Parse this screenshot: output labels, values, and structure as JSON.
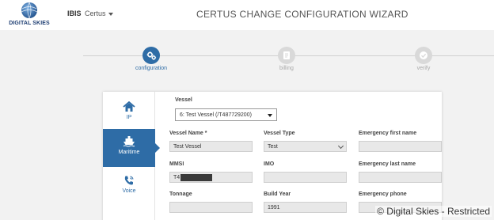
{
  "header": {
    "logo_text": "DIGITAL SKIES",
    "brand": "IBIS",
    "product_menu": "Certus",
    "title": "CERTUS CHANGE CONFIGURATION WIZARD"
  },
  "steps": [
    {
      "label": "configuration",
      "icon": "gears-icon",
      "state": "active"
    },
    {
      "label": "billing",
      "icon": "document-icon",
      "state": "inactive"
    },
    {
      "label": "verify",
      "icon": "check-icon",
      "state": "inactive"
    }
  ],
  "side_nav": [
    {
      "label": "IP",
      "icon": "home-icon",
      "selected": false
    },
    {
      "label": "Maritime",
      "icon": "ship-icon",
      "selected": true
    },
    {
      "label": "Voice",
      "icon": "phone-icon",
      "selected": false
    }
  ],
  "form": {
    "vessel_label": "Vessel",
    "vessel_selected": "6: Test Vessel (/T487729200)",
    "vessel_name_label": "Vessel Name *",
    "vessel_name_value": "Test Vessel",
    "vessel_type_label": "Vessel Type",
    "vessel_type_value": "Test",
    "emergency_first_name_label": "Emergency first name",
    "emergency_first_name_value": "",
    "mmsi_label": "MMSI",
    "mmsi_value_visible": "T4",
    "imo_label": "IMO",
    "imo_value": "",
    "emergency_last_name_label": "Emergency last name",
    "emergency_last_name_value": "",
    "tonnage_label": "Tonnage",
    "tonnage_value": "",
    "build_year_label": "Build Year",
    "build_year_value": "1991",
    "emergency_phone_label": "Emergency phone",
    "emergency_phone_value": ""
  },
  "watermark": "© Digital Skies - Restricted",
  "colors": {
    "accent": "#2e6ca6",
    "inactive_step": "#d9d9d9",
    "background": "#f2f2f2",
    "logo_text": "#1f3f73"
  }
}
